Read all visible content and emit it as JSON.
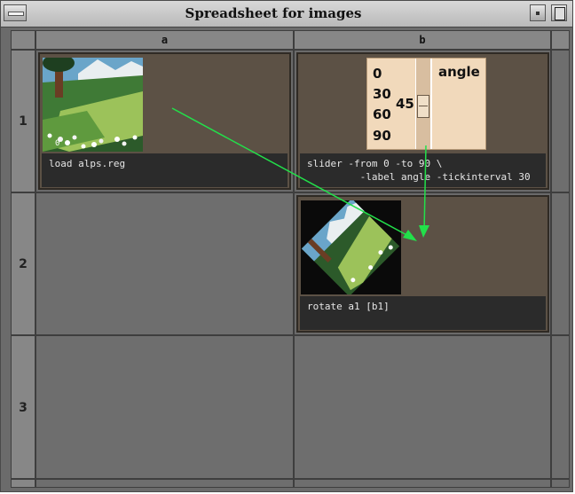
{
  "window": {
    "title": "Spreadsheet for images"
  },
  "columns": [
    "a",
    "b"
  ],
  "rows": [
    "1",
    "2",
    "3"
  ],
  "cells": {
    "a1": {
      "formula": "load alps.reg",
      "image_corner_label": "0"
    },
    "b1": {
      "formula": "slider -from 0 -to 90 \\\n         -label angle -tickinterval 30",
      "slider": {
        "ticks": [
          "0",
          "30",
          "60",
          "90"
        ],
        "value": "45",
        "label": "angle"
      }
    },
    "b2": {
      "formula": "rotate a1 [b1]"
    }
  },
  "colors": {
    "panel": "#5c5145",
    "cell_empty": "#6e6e6e",
    "slider_bg": "#f1d9bb",
    "arrow": "#22e04a"
  }
}
